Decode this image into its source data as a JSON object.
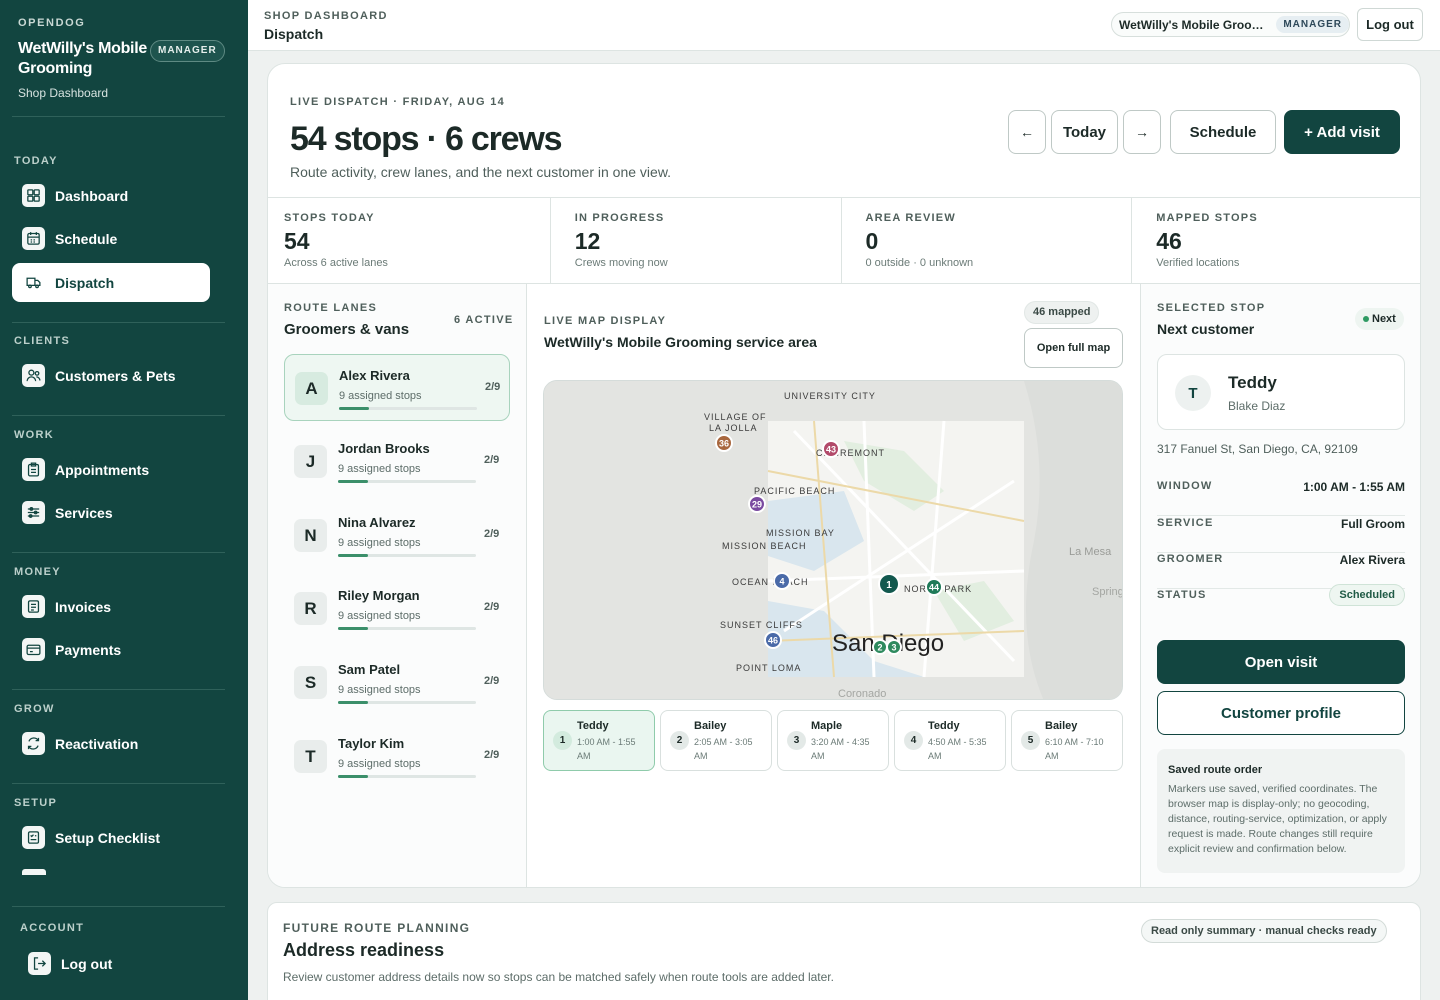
{
  "brand": {
    "eyebrow": "OPENDOG",
    "name": "WetWilly's Mobile Grooming",
    "role": "MANAGER",
    "subtitle": "Shop Dashboard"
  },
  "sidebar": {
    "sections": {
      "today": "TODAY",
      "clients": "CLIENTS",
      "work": "WORK",
      "money": "MONEY",
      "grow": "GROW",
      "setup": "SETUP",
      "account": "ACCOUNT"
    },
    "items": {
      "dashboard": {
        "label": "Dashboard",
        "icon": "dashboard-icon"
      },
      "schedule": {
        "label": "Schedule",
        "icon": "calendar-icon"
      },
      "dispatch": {
        "label": "Dispatch",
        "icon": "truck-icon"
      },
      "customers": {
        "label": "Customers & Pets",
        "icon": "people-icon"
      },
      "appointments": {
        "label": "Appointments",
        "icon": "clipboard-icon"
      },
      "services": {
        "label": "Services",
        "icon": "sliders-icon"
      },
      "invoices": {
        "label": "Invoices",
        "icon": "document-icon"
      },
      "payments": {
        "label": "Payments",
        "icon": "card-icon"
      },
      "reactivation": {
        "label": "Reactivation",
        "icon": "refresh-icon"
      },
      "setup_checklist": {
        "label": "Setup Checklist",
        "icon": "checklist-icon"
      },
      "logout": {
        "label": "Log out",
        "icon": "logout-icon"
      }
    }
  },
  "topbar": {
    "eyebrow": "SHOP DASHBOARD",
    "title": "Dispatch",
    "shop_name": "WetWilly's Mobile Groom...",
    "role": "MANAGER",
    "logout": "Log out"
  },
  "hero": {
    "eyebrow": "LIVE DISPATCH · FRIDAY, AUG 14",
    "title": "54 stops · 6 crews",
    "subtitle": "Route activity, crew lanes, and the next customer in one view.",
    "prev": "←",
    "today": "Today",
    "next": "→",
    "schedule": "Schedule",
    "add_visit": "+ Add visit"
  },
  "kpis": [
    {
      "label": "STOPS TODAY",
      "value": "54",
      "note": "Across 6 active lanes"
    },
    {
      "label": "IN PROGRESS",
      "value": "12",
      "note": "Crews moving now"
    },
    {
      "label": "AREA REVIEW",
      "value": "0",
      "note": "0 outside · 0 unknown"
    },
    {
      "label": "MAPPED STOPS",
      "value": "46",
      "note": "Verified locations"
    }
  ],
  "lanes": {
    "eyebrow": "ROUTE LANES",
    "title": "Groomers & vans",
    "active_count": "6 ACTIVE",
    "items": [
      {
        "initial": "A",
        "name": "Alex Rivera",
        "stops": "9 assigned stops",
        "count": "2/9",
        "progress": 0.22
      },
      {
        "initial": "J",
        "name": "Jordan Brooks",
        "stops": "9 assigned stops",
        "count": "2/9",
        "progress": 0.22
      },
      {
        "initial": "N",
        "name": "Nina Alvarez",
        "stops": "9 assigned stops",
        "count": "2/9",
        "progress": 0.22
      },
      {
        "initial": "R",
        "name": "Riley Morgan",
        "stops": "9 assigned stops",
        "count": "2/9",
        "progress": 0.22
      },
      {
        "initial": "S",
        "name": "Sam Patel",
        "stops": "9 assigned stops",
        "count": "2/9",
        "progress": 0.22
      },
      {
        "initial": "T",
        "name": "Taylor Kim",
        "stops": "9 assigned stops",
        "count": "2/9",
        "progress": 0.22
      }
    ]
  },
  "map": {
    "eyebrow": "LIVE MAP DISPLAY",
    "title": "WetWilly's Mobile Grooming service area",
    "mapped": "46 mapped",
    "open_full": "Open full map",
    "labels": {
      "university_city": "UNIVERSITY CITY",
      "village_of": "VILLAGE OF",
      "la_jolla_1": "LA JOLLA",
      "clairemont": "CLAIREMONT",
      "pacific_beach": "PACIFIC BEACH",
      "mission_bay": "MISSION BAY",
      "mission_beach": "MISSION BEACH",
      "ocean_beach": "OCEAN BEACH",
      "north_park": "NORTH PARK",
      "sunset_cliffs": "SUNSET CLIFFS",
      "san_diego": "San Diego",
      "point_loma": "POINT LOMA",
      "la_mesa": "La Mesa",
      "coronado": "Coronado",
      "spring": "Spring"
    },
    "markers": [
      "36",
      "43",
      "29",
      "4",
      "1",
      "44",
      "46",
      "2",
      "3"
    ]
  },
  "stops": [
    {
      "num": "1",
      "pet": "Teddy",
      "time": "1:00 AM - 1:55 AM"
    },
    {
      "num": "2",
      "pet": "Bailey",
      "time": "2:05 AM - 3:05 AM"
    },
    {
      "num": "3",
      "pet": "Maple",
      "time": "3:20 AM - 4:35 AM"
    },
    {
      "num": "4",
      "pet": "Teddy",
      "time": "4:50 AM - 5:35 AM"
    },
    {
      "num": "5",
      "pet": "Bailey",
      "time": "6:10 AM - 7:10 AM"
    }
  ],
  "selected": {
    "eyebrow": "SELECTED STOP",
    "title": "Next customer",
    "badge": "Next",
    "initial": "T",
    "pet": "Teddy",
    "owner": "Blake Diaz",
    "address": "317 Fanuel St, San Diego, CA, 92109",
    "window_label": "WINDOW",
    "window": "1:00 AM - 1:55 AM",
    "service_label": "SERVICE",
    "service": "Full Groom",
    "groomer_label": "GROOMER",
    "groomer": "Alex Rivera",
    "status_label": "STATUS",
    "status": "Scheduled",
    "open_visit": "Open visit",
    "customer_profile": "Customer profile",
    "note_title": "Saved route order",
    "note_body": "Markers use saved, verified coordinates. The browser map is display-only; no geocoding, distance, routing-service, optimization, or apply request is made. Route changes still require explicit review and confirmation below."
  },
  "future": {
    "eyebrow": "FUTURE ROUTE PLANNING",
    "title": "Address readiness",
    "subtitle": "Review customer address details now so stops can be matched safely when route tools are added later.",
    "badge": "Read only summary · manual checks ready"
  },
  "colors": {
    "sidebar": "#124540",
    "primary": "#124540",
    "accent_green": "#3b8f6a"
  }
}
